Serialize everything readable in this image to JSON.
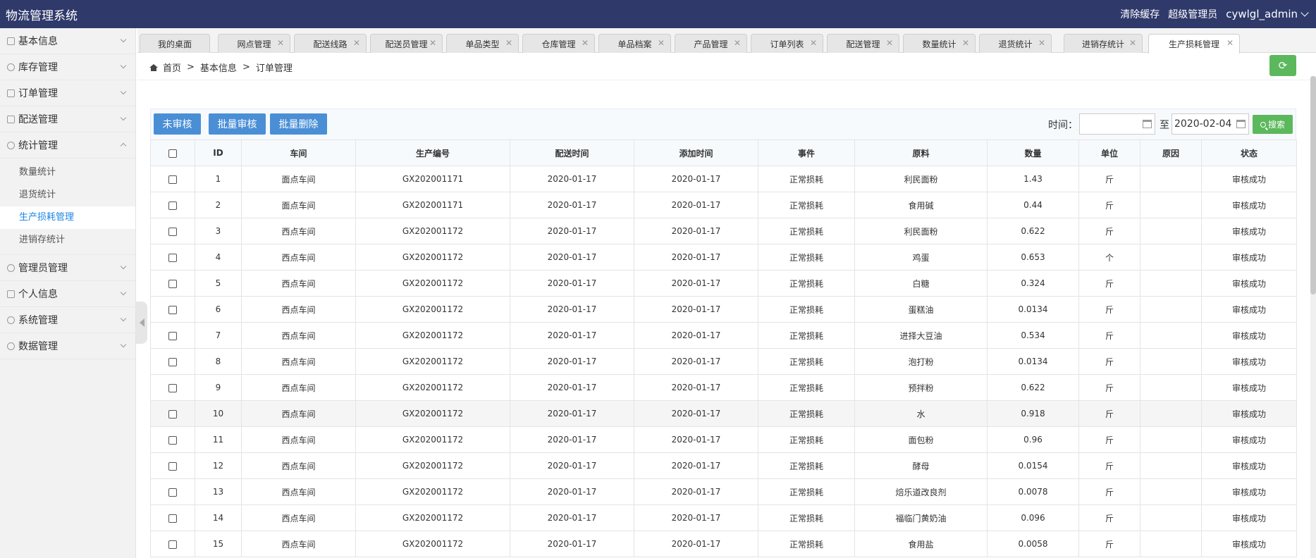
{
  "header": {
    "app_title": "物流管理系统",
    "clear_cache": "清除缓存",
    "role": "超级管理员",
    "username": "cywlgl_admin"
  },
  "sidebar": {
    "items": [
      {
        "label": "基本信息",
        "icon": "info-icon"
      },
      {
        "label": "库存管理",
        "icon": "user-icon"
      },
      {
        "label": "订单管理",
        "icon": "grid-icon"
      },
      {
        "label": "配送管理",
        "icon": "list-icon"
      },
      {
        "label": "统计管理",
        "icon": "user-icon"
      },
      {
        "label": "管理员管理",
        "icon": "user-icon"
      },
      {
        "label": "个人信息",
        "icon": "card-icon"
      },
      {
        "label": "系统管理",
        "icon": "gear-icon"
      },
      {
        "label": "数据管理",
        "icon": "database-icon"
      }
    ],
    "submenu": [
      "数量统计",
      "退货统计",
      "生产损耗管理",
      "进销存统计"
    ],
    "active_sub": "生产损耗管理"
  },
  "tabs": [
    "我的桌面",
    "网点管理",
    "配送线路",
    "配送员管理",
    "单品类型",
    "仓库管理",
    "单品档案",
    "产品管理",
    "订单列表",
    "配送管理",
    "数量统计",
    "退货统计",
    "进销存统计",
    "生产损耗管理"
  ],
  "breadcrumb": {
    "home": "首页",
    "sep": ">",
    "level1": "基本信息",
    "level2": "订单管理"
  },
  "toolbar": {
    "btn_unreviewed": "未审核",
    "btn_batch_review": "批量审核",
    "btn_batch_delete": "批量删除",
    "time_label": "时间：",
    "to_label": "至",
    "date_from": "",
    "date_to": "2020-02-04",
    "search_label": "搜索"
  },
  "table": {
    "columns": [
      "ID",
      "车间",
      "生产编号",
      "配送时间",
      "添加时间",
      "事件",
      "原料",
      "数量",
      "单位",
      "原因",
      "状态"
    ],
    "rows": [
      [
        "1",
        "面点车间",
        "GX202001171",
        "2020-01-17",
        "2020-01-17",
        "正常损耗",
        "利民面粉",
        "1.43",
        "斤",
        "",
        "审核成功"
      ],
      [
        "2",
        "面点车间",
        "GX202001171",
        "2020-01-17",
        "2020-01-17",
        "正常损耗",
        "食用碱",
        "0.44",
        "斤",
        "",
        "审核成功"
      ],
      [
        "3",
        "西点车间",
        "GX202001172",
        "2020-01-17",
        "2020-01-17",
        "正常损耗",
        "利民面粉",
        "0.622",
        "斤",
        "",
        "审核成功"
      ],
      [
        "4",
        "西点车间",
        "GX202001172",
        "2020-01-17",
        "2020-01-17",
        "正常损耗",
        "鸡蛋",
        "0.653",
        "个",
        "",
        "审核成功"
      ],
      [
        "5",
        "西点车间",
        "GX202001172",
        "2020-01-17",
        "2020-01-17",
        "正常损耗",
        "白糖",
        "0.324",
        "斤",
        "",
        "审核成功"
      ],
      [
        "6",
        "西点车间",
        "GX202001172",
        "2020-01-17",
        "2020-01-17",
        "正常损耗",
        "蛋糕油",
        "0.0134",
        "斤",
        "",
        "审核成功"
      ],
      [
        "7",
        "西点车间",
        "GX202001172",
        "2020-01-17",
        "2020-01-17",
        "正常损耗",
        "进择大豆油",
        "0.534",
        "斤",
        "",
        "审核成功"
      ],
      [
        "8",
        "西点车间",
        "GX202001172",
        "2020-01-17",
        "2020-01-17",
        "正常损耗",
        "泡打粉",
        "0.0134",
        "斤",
        "",
        "审核成功"
      ],
      [
        "9",
        "西点车间",
        "GX202001172",
        "2020-01-17",
        "2020-01-17",
        "正常损耗",
        "预拌粉",
        "0.622",
        "斤",
        "",
        "审核成功"
      ],
      [
        "10",
        "西点车间",
        "GX202001172",
        "2020-01-17",
        "2020-01-17",
        "正常损耗",
        "水",
        "0.918",
        "斤",
        "",
        "审核成功"
      ],
      [
        "11",
        "西点车间",
        "GX202001172",
        "2020-01-17",
        "2020-01-17",
        "正常损耗",
        "面包粉",
        "0.96",
        "斤",
        "",
        "审核成功"
      ],
      [
        "12",
        "西点车间",
        "GX202001172",
        "2020-01-17",
        "2020-01-17",
        "正常损耗",
        "酵母",
        "0.0154",
        "斤",
        "",
        "审核成功"
      ],
      [
        "13",
        "西点车间",
        "GX202001172",
        "2020-01-17",
        "2020-01-17",
        "正常损耗",
        "焙乐道改良剂",
        "0.0078",
        "斤",
        "",
        "审核成功"
      ],
      [
        "14",
        "西点车间",
        "GX202001172",
        "2020-01-17",
        "2020-01-17",
        "正常损耗",
        "福临门黄奶油",
        "0.096",
        "斤",
        "",
        "审核成功"
      ],
      [
        "15",
        "西点车间",
        "GX202001172",
        "2020-01-17",
        "2020-01-17",
        "正常损耗",
        "食用盐",
        "0.0058",
        "斤",
        "",
        "审核成功"
      ]
    ],
    "highlight_row": 10
  },
  "colors": {
    "header_bg": "#2f3a6b",
    "primary": "#4a8fd6",
    "success": "#5cb85c",
    "active_link": "#1e88e5"
  }
}
